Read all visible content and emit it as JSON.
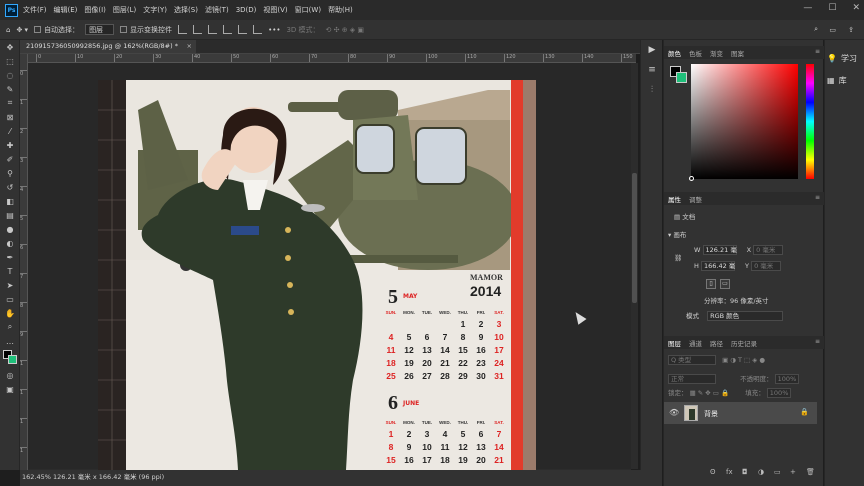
{
  "menu": [
    "文件(F)",
    "编辑(E)",
    "图像(I)",
    "图层(L)",
    "文字(Y)",
    "选择(S)",
    "滤镜(T)",
    "3D(D)",
    "视图(V)",
    "窗口(W)",
    "帮助(H)"
  ],
  "app_logo": "Ps",
  "window_controls": [
    "—",
    "☐",
    "✕"
  ],
  "options": {
    "auto_select_label": "自动选择：",
    "auto_select_value": "图层",
    "show_transform_label": "显示变换控件",
    "mode_3d_label": "3D 模式：",
    "more": "•••"
  },
  "document_tab": {
    "title": "210915736050992856.jpg @ 162%(RGB/8#) *",
    "close": "×"
  },
  "ruler_top_ticks": [
    "0",
    "10",
    "20",
    "30",
    "40",
    "50",
    "60",
    "70",
    "80",
    "90",
    "100",
    "110",
    "120",
    "130",
    "140",
    "150"
  ],
  "ruler_left_ticks": [
    "0",
    "1",
    "2",
    "3",
    "4",
    "5",
    "6",
    "7",
    "8",
    "9",
    "1",
    "1",
    "1",
    "1"
  ],
  "status": {
    "text": "162.45%",
    "detail": "126.21 毫米 x 166.42 毫米 (96 ppi)",
    "arrow": ">"
  },
  "calendar": {
    "brand": "MAMOR",
    "year": "2014",
    "may_num": "5",
    "may_label": "MAY",
    "june_num": "6",
    "june_label": "JUNE",
    "weekdays": [
      "SUN.",
      "MON.",
      "TUE.",
      "WED.",
      "THU.",
      "FRI.",
      "SAT."
    ],
    "may_rows": [
      [
        "",
        "",
        "",
        "",
        "1",
        "2",
        "3"
      ],
      [
        "4",
        "5",
        "6",
        "7",
        "8",
        "9",
        "10"
      ],
      [
        "11",
        "12",
        "13",
        "14",
        "15",
        "16",
        "17"
      ],
      [
        "18",
        "19",
        "20",
        "21",
        "22",
        "23",
        "24"
      ],
      [
        "25",
        "26",
        "27",
        "28",
        "29",
        "30",
        "31"
      ]
    ],
    "june_rows": [
      [
        "1",
        "2",
        "3",
        "4",
        "5",
        "6",
        "7"
      ],
      [
        "8",
        "9",
        "10",
        "11",
        "12",
        "13",
        "14"
      ],
      [
        "15",
        "16",
        "17",
        "18",
        "19",
        "20",
        "21"
      ]
    ]
  },
  "color_panel": {
    "tabs": [
      "颜色",
      "色板",
      "渐变",
      "图案"
    ],
    "fg_color": "#000000",
    "bg_color": "#1fbf7a"
  },
  "properties_panel": {
    "tabs": [
      "属性",
      "调整"
    ],
    "doc_label": "文档",
    "canvas_section": "画布",
    "w_label": "W",
    "w_value": "126.21 毫",
    "x_label": "X",
    "x_value": "0 毫米",
    "h_label": "H",
    "h_value": "166.42 毫",
    "y_label": "Y",
    "y_value": "0 毫米",
    "resolution": "分辨率：96 像素/英寸",
    "mode_label": "模式",
    "mode_value": "RGB 颜色"
  },
  "layers_panel": {
    "tabs": [
      "图层",
      "通道",
      "路径",
      "历史记录"
    ],
    "filter_label": "Q 类型",
    "blend_mode": "正常",
    "opacity_label": "不透明度：",
    "opacity_value": "100%",
    "lock_label": "锁定：",
    "fill_label": "填充：",
    "fill_value": "100%",
    "layer_name": "背景",
    "footer_icons": [
      "ʘ",
      "fx",
      "◘",
      "◑",
      "▭",
      "+",
      "🗑"
    ]
  },
  "far_strip": [
    {
      "icon": "💡",
      "label": "学习"
    },
    {
      "icon": "▦",
      "label": "库"
    }
  ]
}
